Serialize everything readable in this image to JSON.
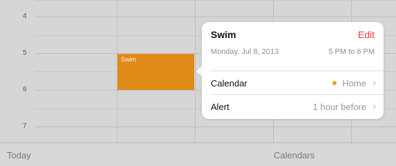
{
  "calendar": {
    "hours": [
      "4",
      "5",
      "6",
      "7"
    ],
    "event": {
      "title": "Swim",
      "color": "#e08a1a"
    }
  },
  "popover": {
    "title": "Swim",
    "edit_label": "Edit",
    "date": "Monday, Jul 8, 2013",
    "time": "5 PM to 6 PM",
    "rows": [
      {
        "label": "Calendar",
        "value": "Home",
        "dot_color": "#f39c12",
        "icon": "chevron-right-icon"
      },
      {
        "label": "Alert",
        "value": "1 hour before",
        "icon": "chevron-right-icon"
      }
    ]
  },
  "toolbar": {
    "today_label": "Today",
    "calendars_label": "Calendars"
  },
  "colors": {
    "accent_edit": "#f0383a",
    "event": "#e08a1a"
  }
}
